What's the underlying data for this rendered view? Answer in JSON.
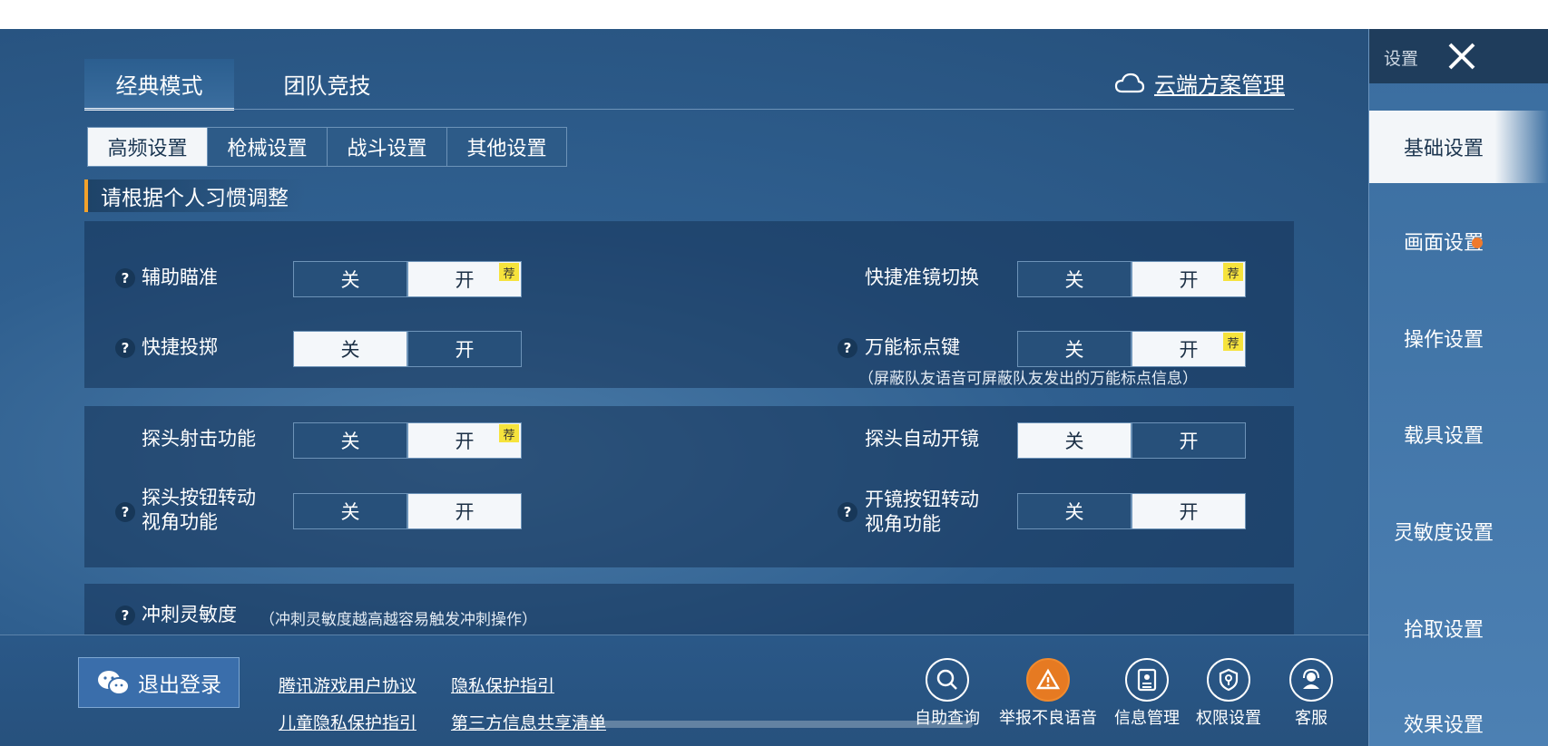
{
  "top_tabs": [
    "经典模式",
    "团队竞技"
  ],
  "cloud_link": "云端方案管理",
  "sub_tabs": [
    "高频设置",
    "枪械设置",
    "战斗设置",
    "其他设置"
  ],
  "section_title": "请根据个人习惯调整",
  "toggle_labels": {
    "off": "关",
    "on": "开"
  },
  "badge": "荐",
  "settings": {
    "aim_assist": {
      "label": "辅助瞄准",
      "state": "on"
    },
    "quick_scope_switch": {
      "label": "快捷准镜切换",
      "state": "on"
    },
    "quick_throw": {
      "label": "快捷投掷",
      "state": "off"
    },
    "universal_marker": {
      "label": "万能标点键",
      "state": "on",
      "note": "（屏蔽队友语音可屏蔽队友发出的万能标点信息）"
    },
    "peek_fire": {
      "label": "探头射击功能",
      "state": "on"
    },
    "peek_auto_scope": {
      "label": "探头自动开镜",
      "state": "off"
    },
    "peek_button_rotate": {
      "label_line1": "探头按钮转动",
      "label_line2": "视角功能",
      "state": "on"
    },
    "scope_button_rotate": {
      "label_line1": "开镜按钮转动",
      "label_line2": "视角功能",
      "state": "on"
    },
    "sprint_sensitivity": {
      "label": "冲刺灵敏度",
      "note": "（冲刺灵敏度越高越容易触发冲刺操作）"
    }
  },
  "bottom": {
    "logout": "退出登录",
    "links": [
      "腾讯游戏用户协议",
      "隐私保护指引",
      "儿童隐私保护指引",
      "第三方信息共享清单"
    ],
    "icons": [
      "自助查询",
      "举报不良语音",
      "信息管理",
      "权限设置",
      "客服"
    ]
  },
  "sidebar": {
    "title": "设置",
    "items": [
      "基础设置",
      "画面设置",
      "操作设置",
      "载具设置",
      "灵敏度设置",
      "拾取设置",
      "效果设置"
    ]
  },
  "colors": {
    "accent": "#f2a22c",
    "badge": "#f6e33c",
    "notification": "#f07a2c"
  }
}
